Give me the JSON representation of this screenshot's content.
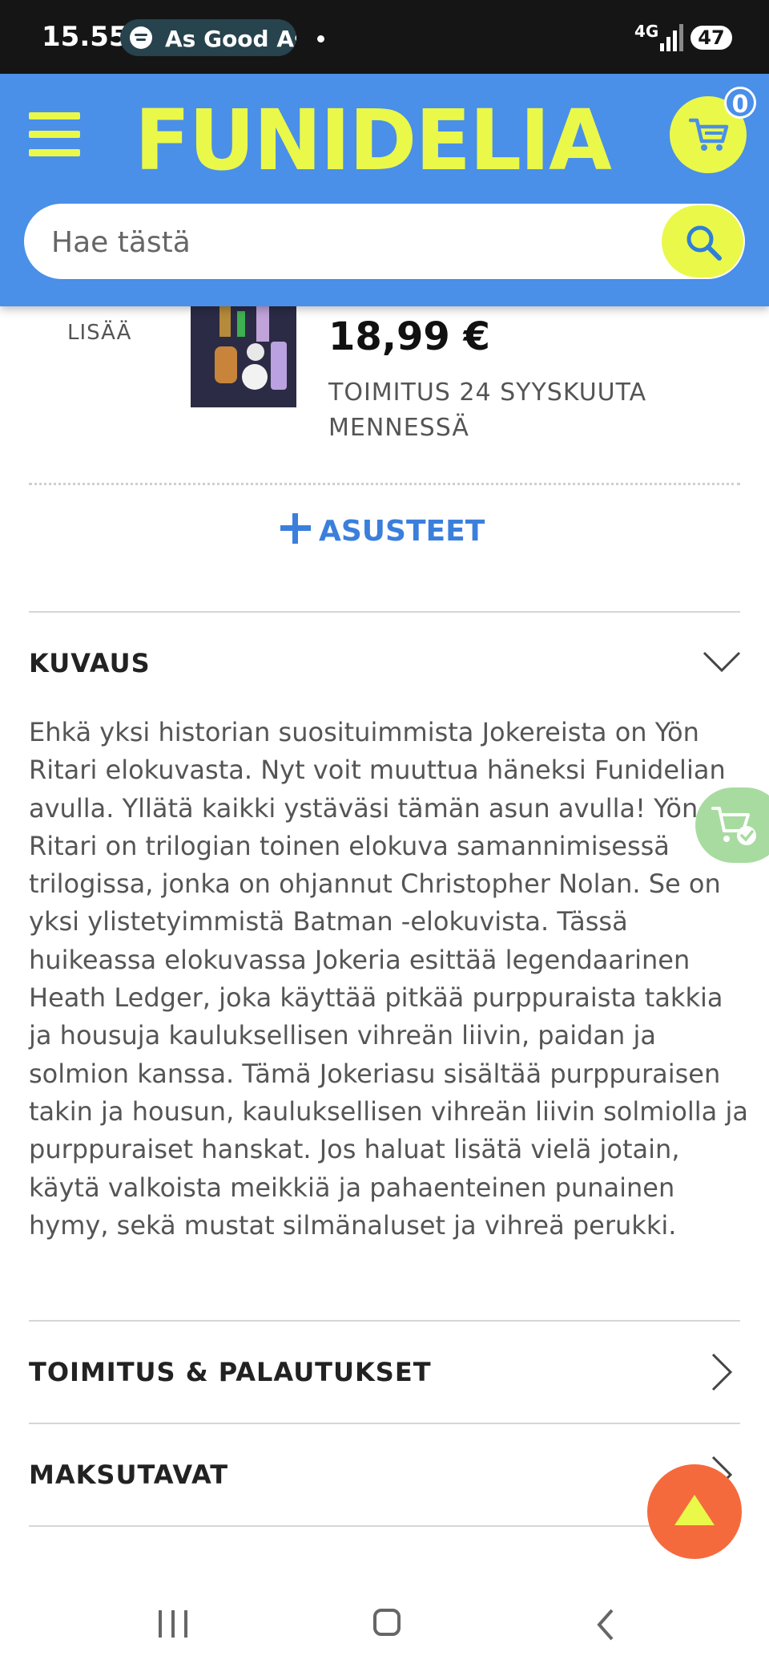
{
  "status_bar": {
    "time": "15.55",
    "media_title": "As Good As",
    "network": "4G",
    "battery": "47"
  },
  "header": {
    "logo": "FUNIDELIA",
    "cart_count": "0",
    "search_placeholder": "Hae tästä",
    "icons": [
      "menu-icon",
      "cart-icon",
      "search-icon"
    ],
    "brand_color": "#4a8fe8",
    "accent_color": "#eaf84a"
  },
  "product": {
    "more_label": "LISÄÄ",
    "price": "18,99 €",
    "delivery": "TOIMITUS 24 SYYSKUUTA MENNESSÄ",
    "accessories_label": "ASUSTEET"
  },
  "sections": {
    "description": {
      "title": "KUVAUS",
      "text": "Ehkä yksi historian suosituimmista Jokereista on Yön Ritari elokuvasta. Nyt voit muuttua häneksi Funidelian avulla. Yllätä kaikki ystäväsi tämän asun avulla! Yön Ritari on trilogian toinen elokuva samannimisessä trilogissa, jonka on ohjannut Christopher Nolan. Se on yksi ylistetyimmistä Batman -elokuvista. Tässä huikeassa elokuvassa Jokeria esittää legendaarinen Heath Ledger, joka käyttää pitkää purppuraista takkia ja housuja kauluksellisen vihreän liivin, paidan ja solmion kanssa. Tämä Jokeriasu sisältää purppuraisen takin ja housun, kauluksellisen vihreän liivin solmiolla ja purppuraiset hanskat. Jos haluat lisätä vielä jotain, käytä valkoista meikkiä ja pahaenteinen punainen hymy, sekä mustat silmänaluset ja vihreä perukki."
    },
    "shipping": {
      "title": "TOIMITUS & PALAUTUKSET"
    },
    "payment": {
      "title": "MAKSUTAVAT"
    }
  },
  "floating": {
    "cart_check_color": "#a8dba0",
    "scroll_top_color": "#f56a3d"
  }
}
